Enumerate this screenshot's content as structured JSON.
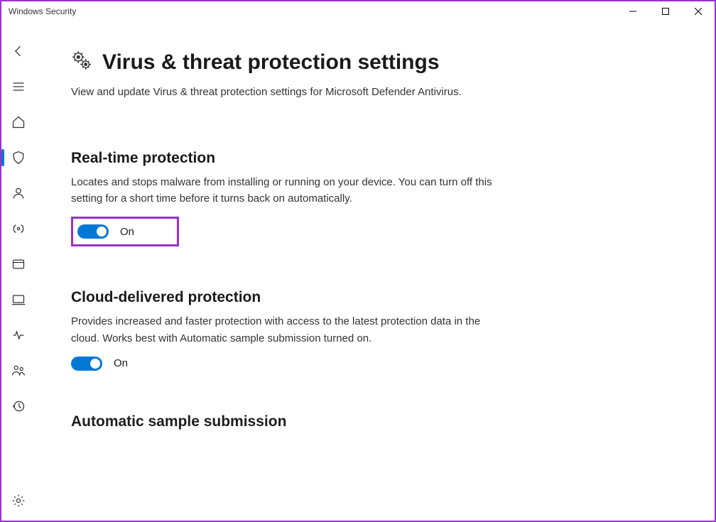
{
  "window": {
    "title": "Windows Security"
  },
  "page": {
    "title": "Virus & threat protection settings",
    "subtitle": "View and update Virus & threat protection settings for Microsoft Defender Antivirus."
  },
  "sections": {
    "realtime": {
      "title": "Real-time protection",
      "desc": "Locates and stops malware from installing or running on your device. You can turn off this setting for a short time before it turns back on automatically.",
      "toggle_state": "On"
    },
    "cloud": {
      "title": "Cloud-delivered protection",
      "desc": "Provides increased and faster protection with access to the latest protection data in the cloud. Works best with Automatic sample submission turned on.",
      "toggle_state": "On"
    },
    "auto_sample": {
      "title": "Automatic sample submission"
    }
  }
}
